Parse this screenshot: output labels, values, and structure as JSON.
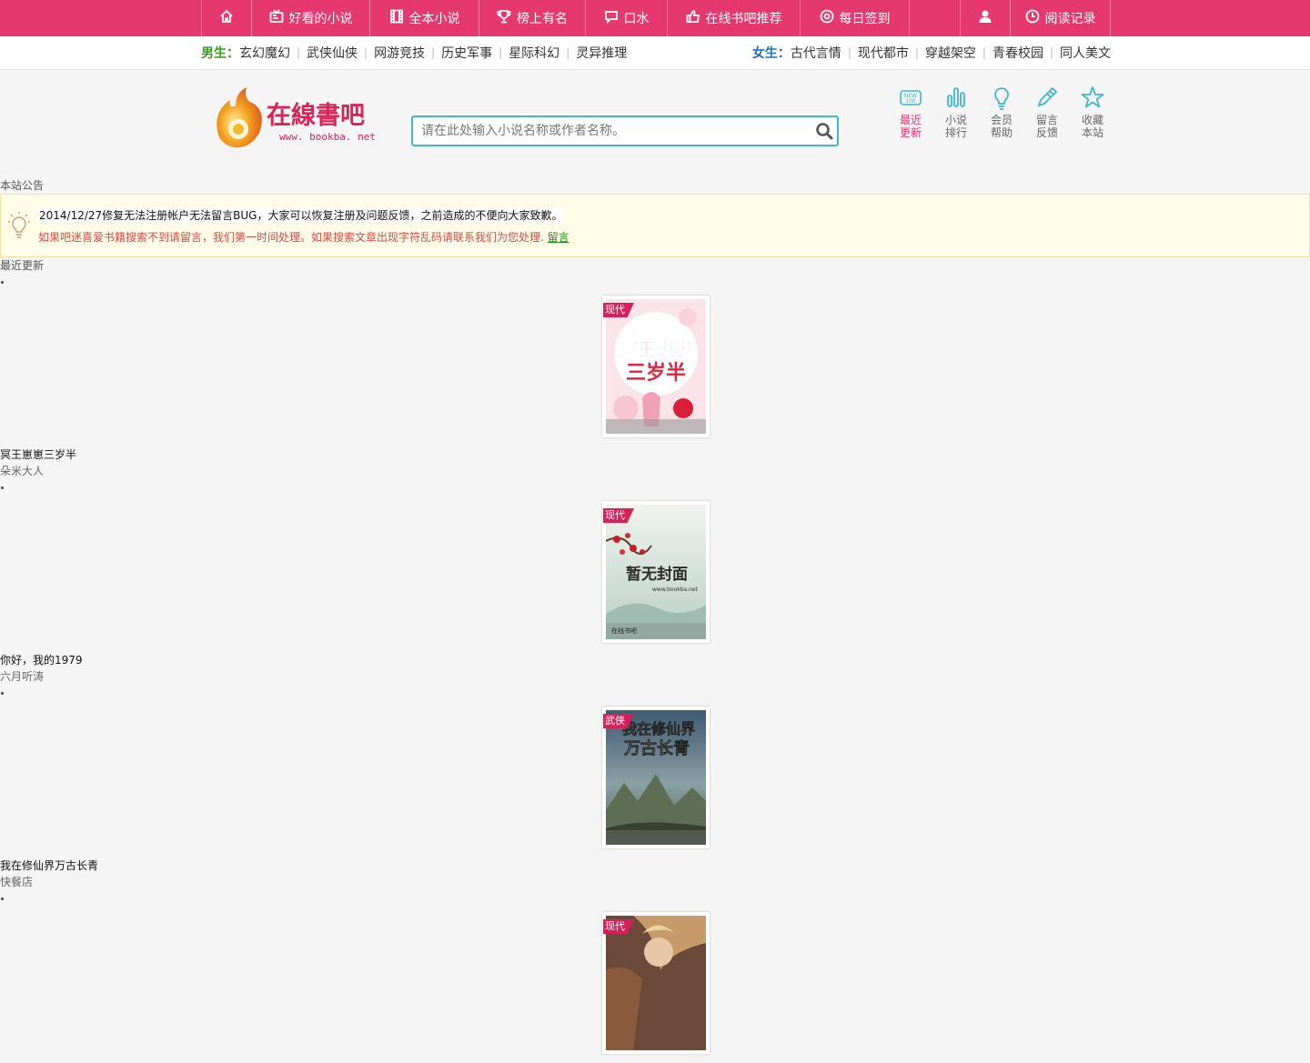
{
  "topnav": {
    "items": [
      {
        "label": "",
        "icon": "home-icon"
      },
      {
        "label": "好看的小说",
        "icon": "tv-icon"
      },
      {
        "label": "全本小说",
        "icon": "film-icon"
      },
      {
        "label": "榜上有名",
        "icon": "trophy-icon"
      },
      {
        "label": "口水",
        "icon": "chat-icon"
      },
      {
        "label": "在线书吧推荐",
        "icon": "thumb-icon"
      },
      {
        "label": "每日签到",
        "icon": "sign-icon"
      },
      {
        "label": "",
        "icon": "blank"
      },
      {
        "label": "",
        "icon": "user-icon"
      },
      {
        "label": "阅读记录",
        "icon": "clock-icon"
      }
    ]
  },
  "genres": {
    "male_label": "男生：",
    "male": [
      "玄幻魔幻",
      "武侠仙侠",
      "网游竞技",
      "历史军事",
      "星际科幻",
      "灵异推理"
    ],
    "female_label": "女生：",
    "female": [
      "古代言情",
      "现代都市",
      "穿越架空",
      "青春校园",
      "同人美文"
    ]
  },
  "header": {
    "logo_text": "在線書吧",
    "logo_url_text": "www. bookba. net",
    "search_placeholder": "请在此处输入小说名称或作者名称。",
    "quick": [
      {
        "line1": "最近",
        "line2": "更新",
        "icon": "new-icon"
      },
      {
        "line1": "小说",
        "line2": "排行",
        "icon": "bar-chart-icon"
      },
      {
        "line1": "会员",
        "line2": "帮助",
        "icon": "bulb-icon"
      },
      {
        "line1": "留言",
        "line2": "反馈",
        "icon": "pencil-icon"
      },
      {
        "line1": "收藏",
        "line2": "本站",
        "icon": "star-icon"
      }
    ]
  },
  "notice": {
    "title": "本站公告",
    "line1": "2014/12/27修复无法注册帐户无法留言BUG，大家可以恢复注册及问题反馈，之前造成的不便向大家致歉。",
    "line2": "如果吧迷喜爱书籍搜索不到请留言，我们第一时间处理。如果搜索文章出现字符乱码请联系我们为您处理.",
    "link": "留言"
  },
  "updates": {
    "title": "最近更新",
    "books": [
      {
        "tag": "现代",
        "title": "冥王崽崽三岁半",
        "author": "朵米大人",
        "cover_text": "冥王崽崽三岁半"
      },
      {
        "tag": "现代",
        "title": "你好，我的1979",
        "author": "六月听涛",
        "cover_text": "暂无封面",
        "cover_sub": "www.bookba.net",
        "cover_brand": "在线书吧"
      },
      {
        "tag": "武侠",
        "title": "我在修仙界万古长青",
        "author": "快餐店",
        "cover_text": "我在修仙界万古长青"
      },
      {
        "tag": "现代",
        "title": "",
        "author": "",
        "cover_text": ""
      }
    ]
  }
}
